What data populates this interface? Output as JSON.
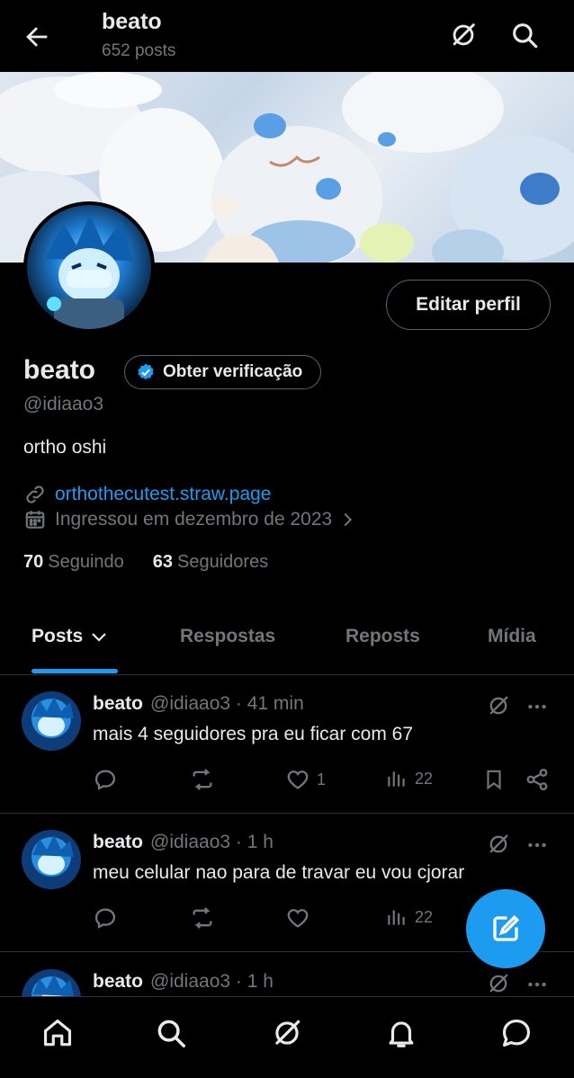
{
  "header": {
    "title": "beato",
    "subtitle": "652 posts",
    "back_icon": "arrow-left-icon",
    "grok_icon": "grok-icon",
    "search_icon": "search-icon"
  },
  "profile": {
    "edit_label": "Editar perfil",
    "name": "beato",
    "verify_label": "Obter verificação",
    "handle": "@idiaao3",
    "bio": "ortho oshi",
    "link": "orthothecutest.straw.page",
    "joined": "Ingressou em dezembro de 2023",
    "following_count": "70",
    "following_label": "Seguindo",
    "followers_count": "63",
    "followers_label": "Seguidores"
  },
  "tabs": [
    {
      "label": "Posts"
    },
    {
      "label": "Respostas"
    },
    {
      "label": "Reposts"
    },
    {
      "label": "Mídia"
    }
  ],
  "posts": [
    {
      "name": "beato",
      "meta": "@idiaao3 · 41 min",
      "text": "mais 4 seguidores pra eu ficar com 67",
      "likes": "1",
      "views": "22"
    },
    {
      "name": "beato",
      "meta": "@idiaao3 · 1 h",
      "text": "meu celular nao para de travar eu vou cjorar",
      "likes": "",
      "views": "22"
    },
    {
      "name": "beato",
      "meta": "@idiaao3 · 1 h",
      "text": ""
    }
  ],
  "colors": {
    "accent": "#1d9bf0",
    "background": "#000000",
    "text": "#e7e9ea",
    "muted": "#71767b",
    "border": "#2f3336"
  },
  "bottom_nav": [
    "home-icon",
    "search-icon",
    "grok-icon",
    "notifications-icon",
    "messages-icon"
  ]
}
